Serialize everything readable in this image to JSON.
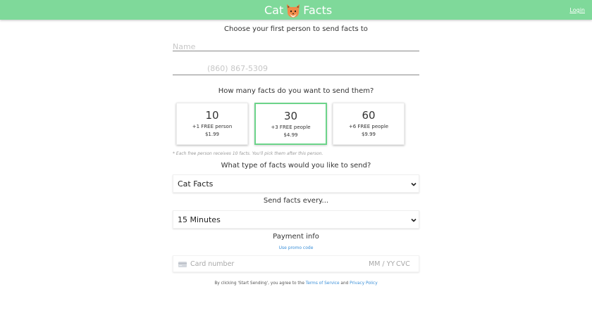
{
  "header": {
    "title_left": "Cat",
    "title_right": "Facts",
    "login_label": "Login",
    "logo_icon": "fox-cat-face-icon",
    "bar_color": "#7fd99a"
  },
  "recipient": {
    "heading": "Choose your first person to send facts to",
    "name_placeholder": "Name",
    "phone_placeholder": "(860) 867-5309"
  },
  "plans": {
    "heading": "How many facts do you want to send them?",
    "selected_index": 1,
    "options": [
      {
        "count": "10",
        "free": "+1 FREE person",
        "price": "$1.99"
      },
      {
        "count": "30",
        "free": "+3 FREE people",
        "price": "$4.99"
      },
      {
        "count": "60",
        "free": "+6 FREE people",
        "price": "$9.99"
      }
    ],
    "note": "* Each free person receives 10 facts. You'll pick them after this person."
  },
  "fact_type": {
    "heading": "What type of facts would you like to send?",
    "selected": "Cat Facts"
  },
  "frequency": {
    "heading": "Send facts every...",
    "selected": "15 Minutes"
  },
  "payment": {
    "heading": "Payment info",
    "promo_label": "Use promo code",
    "card_placeholder": "Card number",
    "expiry_placeholder": "MM / YY",
    "cvc_placeholder": "CVC"
  },
  "terms": {
    "prefix": "By clicking 'Start Sending', you agree to the",
    "tos_label": "Terms of Service",
    "and": "and",
    "privacy_label": "Privacy Policy"
  },
  "colors": {
    "accent_green": "#6cd48a",
    "link_blue": "#3a8fd8"
  }
}
